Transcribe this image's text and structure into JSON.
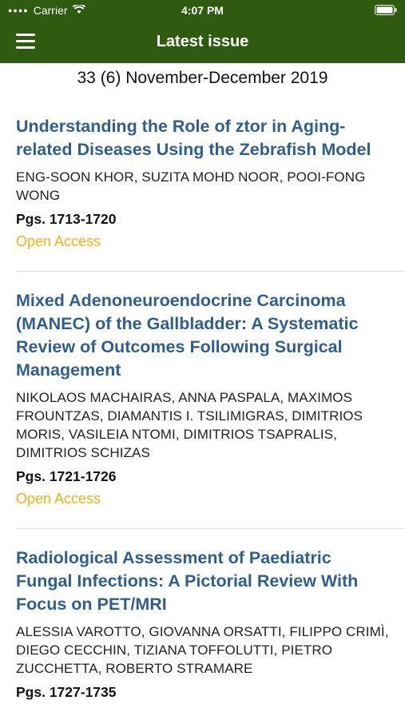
{
  "status": {
    "carrier": "Carrier",
    "time": "4:07 PM",
    "battery_icon": "battery-icon",
    "wifi_icon": "wifi-icon"
  },
  "nav": {
    "title": "Latest issue",
    "menu_icon": "hamburger-menu-icon"
  },
  "issue": {
    "label": "33 (6) November-December 2019"
  },
  "colors": {
    "nav_bg": "#2e5b0f",
    "title_link": "#2f5f8f",
    "open_access": "#f5b017"
  },
  "articles": [
    {
      "title": "Understanding the Role of ztor in Aging-related Diseases Using the Zebrafish Model",
      "authors": "ENG-SOON KHOR, SUZITA MOHD NOOR, POOI-FONG WONG",
      "pages": "Pgs. 1713-1720",
      "access": "Open Access"
    },
    {
      "title": "Mixed Adenoneuroendocrine Carcinoma (MANEC) of the Gallbladder: A Systematic Review of Outcomes Following Surgical Management",
      "authors": "NIKOLAOS MACHAIRAS, ANNA PASPALA, MAXIMOS FROUNTZAS, DIAMANTIS I. TSILIMIGRAS, DIMITRIOS MORIS, VASILEIA NTOMI, DIMITRIOS TSAPRALIS, DIMITRIOS SCHIZAS",
      "pages": "Pgs. 1721-1726",
      "access": "Open Access"
    },
    {
      "title": "Radiological Assessment of Paediatric Fungal Infections: A Pictorial Review With Focus on PET/MRI",
      "authors": "ALESSIA VAROTTO, GIOVANNA ORSATTI, FILIPPO CRIMÌ, DIEGO CECCHIN, TIZIANA TOFFOLUTTI, PIETRO ZUCCHETTA, ROBERTO STRAMARE",
      "pages": "Pgs. 1727-1735",
      "access": ""
    }
  ]
}
